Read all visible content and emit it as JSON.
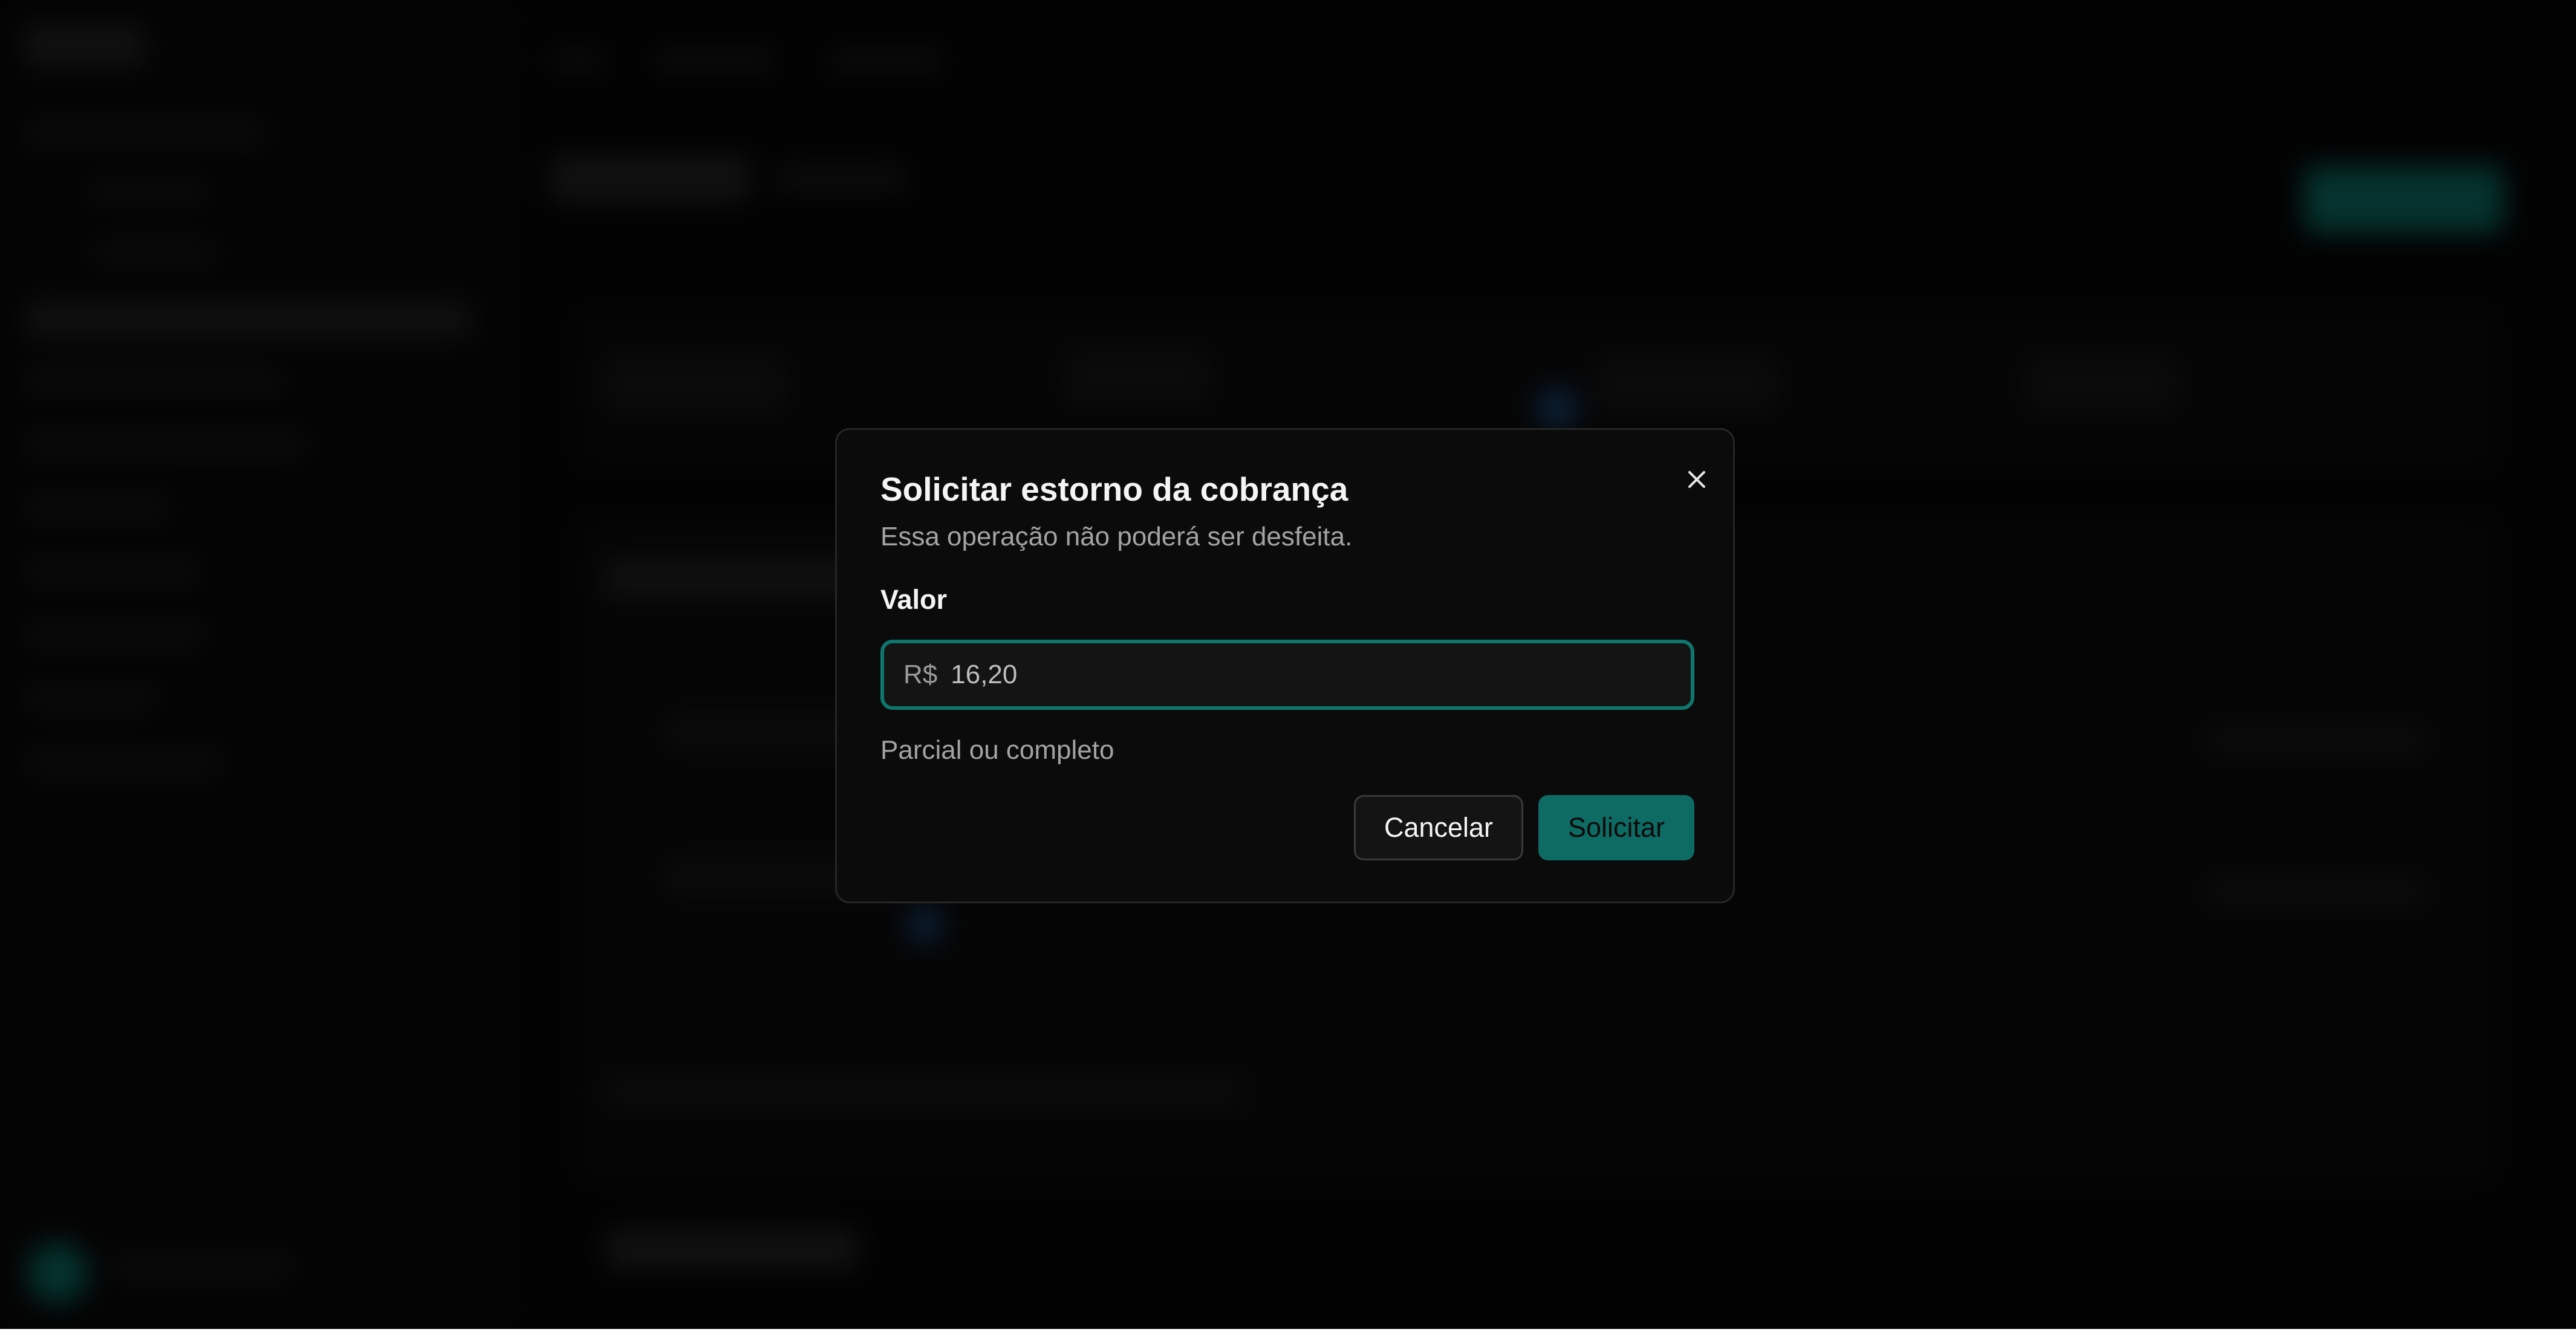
{
  "dialog": {
    "title": "Solicitar estorno da cobrança",
    "subtitle": "Essa operação não poderá ser desfeita.",
    "field_label": "Valor",
    "currency_prefix": "R$",
    "amount_value": "16,20",
    "helper_text": "Parcial ou completo",
    "cancel_label": "Cancelar",
    "submit_label": "Solicitar",
    "close_icon": "close-icon"
  },
  "colors": {
    "accent": "#0f766e",
    "primary_button": "#0d6b63",
    "modal_background": "#0b0b0b",
    "page_background": "#050505"
  }
}
